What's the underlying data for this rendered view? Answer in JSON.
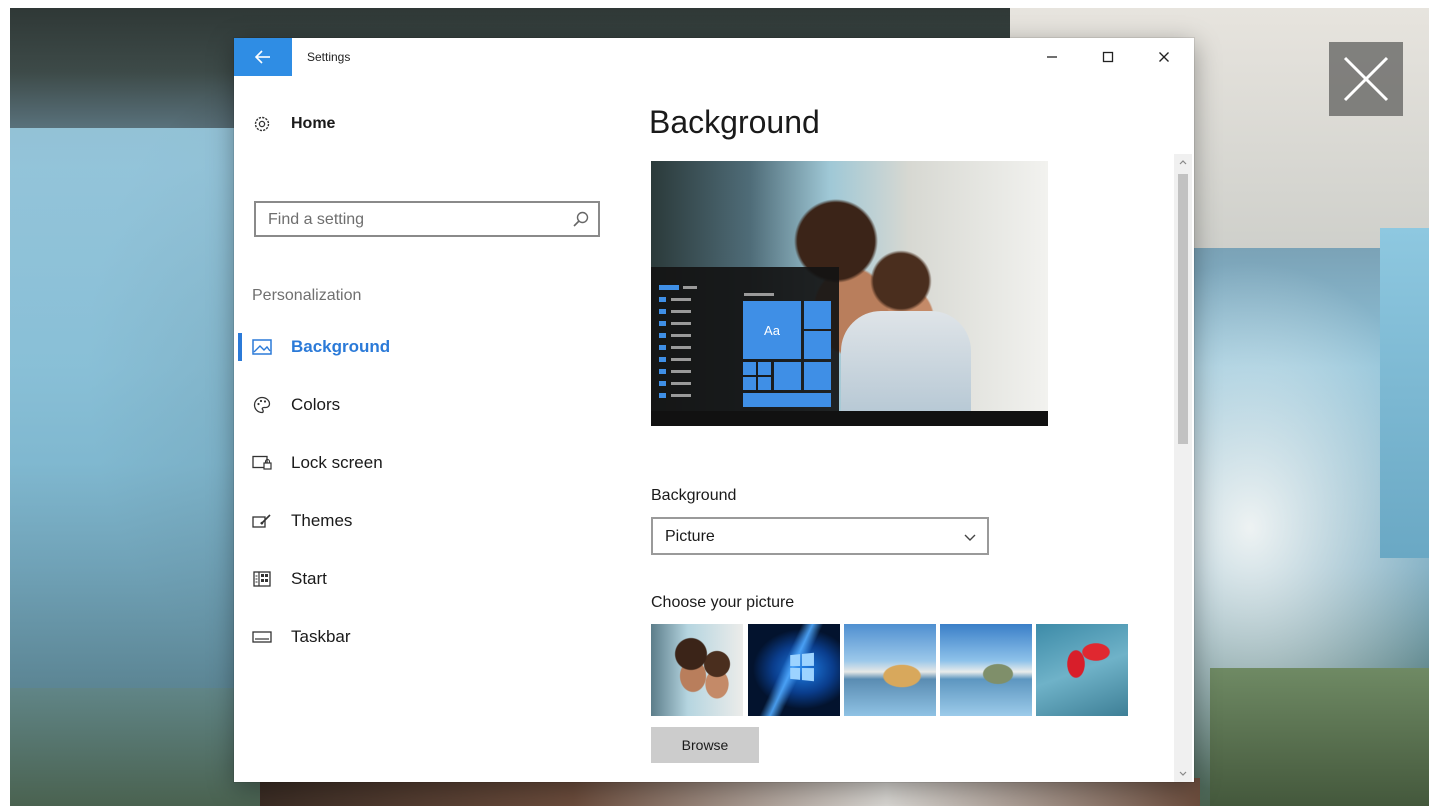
{
  "window": {
    "title": "Settings"
  },
  "nav": {
    "home_label": "Home",
    "search_placeholder": "Find a setting",
    "section_label": "Personalization",
    "items": [
      {
        "label": "Background",
        "icon": "picture-icon",
        "selected": true
      },
      {
        "label": "Colors",
        "icon": "palette-icon",
        "selected": false
      },
      {
        "label": "Lock screen",
        "icon": "lock-screen-icon",
        "selected": false
      },
      {
        "label": "Themes",
        "icon": "themes-icon",
        "selected": false
      },
      {
        "label": "Start",
        "icon": "start-tiles-icon",
        "selected": false
      },
      {
        "label": "Taskbar",
        "icon": "taskbar-icon",
        "selected": false
      }
    ]
  },
  "content": {
    "title": "Background",
    "preview_tile_text": "Aa",
    "background_label": "Background",
    "background_value": "Picture",
    "choose_label": "Choose your picture",
    "thumbnails": [
      "children-photo",
      "windows-logo",
      "beach-rock-1",
      "beach-rock-2",
      "red-flower"
    ],
    "browse_label": "Browse"
  },
  "colors": {
    "accent": "#2f8de4",
    "selected_text": "#2b7ad8"
  }
}
